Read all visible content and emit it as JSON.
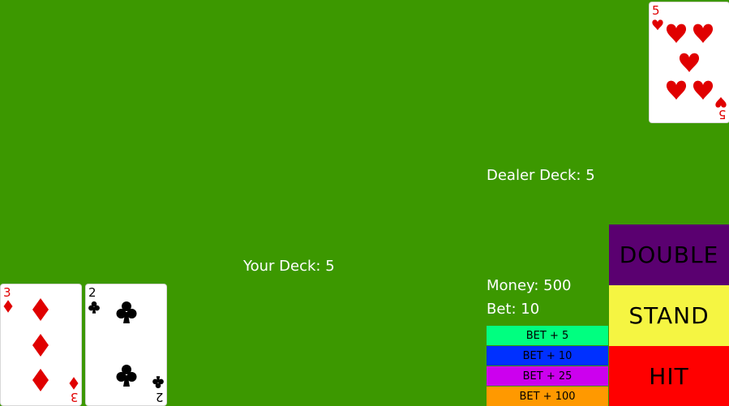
{
  "table": {
    "felt_color": "#3c9800"
  },
  "dealer": {
    "deck_label": "Dealer Deck: 5",
    "cards": [
      {
        "rank": "5",
        "suit": "hearts",
        "color": "#e00000"
      }
    ]
  },
  "player": {
    "deck_label": "Your Deck: 5",
    "money_label": "Money: 500",
    "bet_label": "Bet: 10",
    "cards": [
      {
        "rank": "3",
        "suit": "diamonds",
        "color": "#e00000"
      },
      {
        "rank": "2",
        "suit": "clubs",
        "color": "#000000"
      }
    ]
  },
  "bet_buttons": [
    {
      "label": "BET + 5",
      "color": "#00ff80"
    },
    {
      "label": "BET + 10",
      "color": "#0030ff"
    },
    {
      "label": "BET + 25",
      "color": "#cc00ee"
    },
    {
      "label": "BET + 100",
      "color": "#ff9900"
    }
  ],
  "actions": {
    "double": {
      "label": "DOUBLE",
      "color": "#5a0070"
    },
    "stand": {
      "label": "STAND",
      "color": "#f5f542"
    },
    "hit": {
      "label": "HIT",
      "color": "#ff0000"
    }
  }
}
